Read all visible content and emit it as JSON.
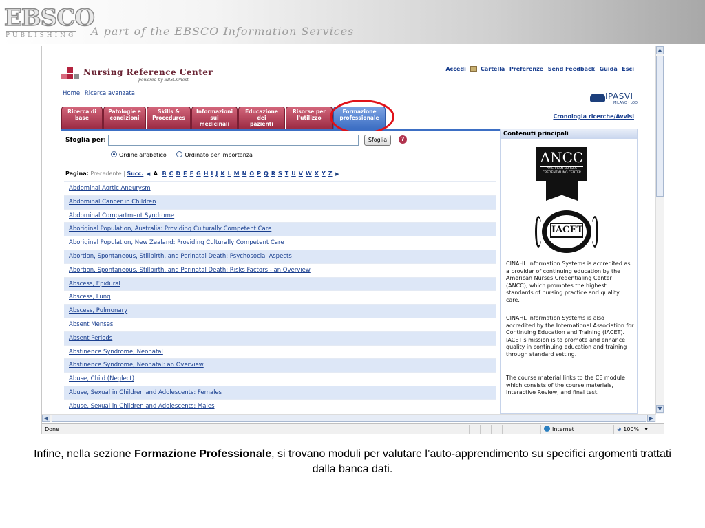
{
  "banner": {
    "logo_big": "EBSCO",
    "logo_small": "PUBLISHING",
    "tagline": "A part of the EBSCO Information Services"
  },
  "site": {
    "title": "Nursing Reference Center",
    "powered_by": "powered by EBSCOhost",
    "logo_colors": [
      "#b4233f",
      "#d86a7e",
      "#8a8a8a"
    ]
  },
  "toplinks": {
    "accedi": "Accedi",
    "cartella": "Cartella",
    "preferenze": "Preferenze",
    "send_feedback": "Send Feedback",
    "guida": "Guida",
    "esci": "Esci"
  },
  "subnav": {
    "home": "Home",
    "ricerca_avanzata": "Ricerca avanzata"
  },
  "ipasvi": {
    "name": "IPASVI",
    "sub": "MILANO · LODI"
  },
  "tabs": [
    {
      "label": "Ricerca di\nbase",
      "active": false
    },
    {
      "label": "Patologie e\ncondizioni",
      "active": false
    },
    {
      "label": "Skills &\nProcedures",
      "active": false
    },
    {
      "label": "Informazioni\nsui\nmedicinali",
      "active": false
    },
    {
      "label": "Educazione\ndei\npazienti",
      "active": false
    },
    {
      "label": "Risorse per\nl'utilizzo",
      "active": false
    },
    {
      "label": "Formazione\nprofessionale",
      "active": true
    }
  ],
  "cronologia": "Cronologia ricerche/Avvisi",
  "browse": {
    "label": "Sfoglia per:",
    "input_value": "",
    "button": "Sfoglia",
    "help": "?",
    "radio_alpha": "Ordine alfabetico",
    "radio_importance": "Ordinato per importanza",
    "selected_sort": "Ordine alfabetico"
  },
  "pager": {
    "label": "Pagina:",
    "prev": "Precedente",
    "sep": "|",
    "next": "Succ.",
    "current_letter": "A",
    "letters": [
      "B",
      "C",
      "D",
      "E",
      "F",
      "G",
      "H",
      "I",
      "J",
      "K",
      "L",
      "M",
      "N",
      "O",
      "P",
      "Q",
      "R",
      "S",
      "T",
      "U",
      "V",
      "W",
      "X",
      "Y",
      "Z"
    ]
  },
  "results": [
    "Abdominal Aortic Aneurysm",
    "Abdominal Cancer in Children",
    "Abdominal Compartment Syndrome",
    "Aboriginal Population, Australia: Providing Culturally Competent Care",
    "Aboriginal Population, New Zealand: Providing Culturally Competent Care",
    "Abortion, Spontaneous, Stillbirth, and Perinatal Death: Psychosocial Aspects",
    "Abortion, Spontaneous, Stillbirth, and Perinatal Death: Risks Factors - an Overview",
    "Abscess, Epidural",
    "Abscess, Lung",
    "Abscess, Pulmonary",
    "Absent Menses",
    "Absent Periods",
    "Abstinence Syndrome, Neonatal",
    "Abstinence Syndrome, Neonatal: an Overview",
    "Abuse, Child (Neglect)",
    "Abuse, Sexual in Children and Adolescents: Females",
    "Abuse, Sexual in Children and Adolescents: Males"
  ],
  "sidebar": {
    "title": "Contenuti principali",
    "ancc_big": "ANCC",
    "ancc_small": "AMERICAN NURSES CREDENTIALING CENTER",
    "iacet": "IACET",
    "p1": "CINAHL Information Systems is accredited as a provider of continuing education by the American Nurses Credentialing Center (ANCC), which promotes the highest standards of nursing practice and quality care.",
    "p2": "CINAHL Information Systems is also accredited by the International Association for Continuing Education and Training (IACET). IACET's mission is to promote and enhance quality in continuing education and training through standard setting.",
    "p3": "The course material links to the CE module which consists of the course materials, Interactive Review, and final test."
  },
  "status": {
    "done": "Done",
    "zone": "Internet",
    "zoom": "100%"
  },
  "caption": {
    "pre": "Infine, nella sezione ",
    "bold": "Formazione Professionale",
    "post": ", si trovano moduli per valutare l’auto-apprendimento su specifici argomenti trattati dalla banca dati."
  },
  "colors": {
    "tab_red": "#b1334e",
    "tab_active_blue": "#3d6fc4",
    "link_blue": "#1a3f8f",
    "highlight_red": "#e0121a",
    "row_alt": "#dde7f7"
  }
}
